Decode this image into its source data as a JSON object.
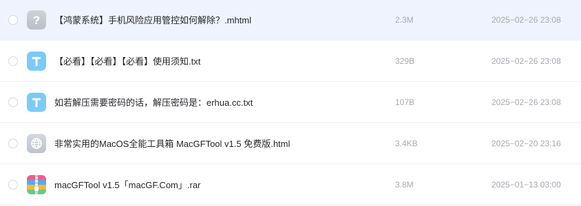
{
  "files": [
    {
      "name": "【鸿蒙系统】手机风险应用管控如何解除？.mhtml",
      "size": "2.3M",
      "date": "2025−02−26 23:08",
      "icon": "unknown-file-icon",
      "selected": true
    },
    {
      "name": "【必看】【必看】【必看】使用须知.txt",
      "size": "329B",
      "date": "2025−02−26 23:08",
      "icon": "text-file-icon",
      "selected": false
    },
    {
      "name": "如若解压需要密码的话，解压密码是：erhua.cc.txt",
      "size": "107B",
      "date": "2025−02−26 23:08",
      "icon": "text-file-icon",
      "selected": false
    },
    {
      "name": "非常实用的MacOS全能工具箱 MacGFTool v1.5 免费版.html",
      "size": "3.4KB",
      "date": "2025−02−20 23:16",
      "icon": "web-file-icon",
      "selected": false
    },
    {
      "name": "macGFTool v1.5「macGF.Com」.rar",
      "size": "3.8M",
      "date": "2025−01−13 03:00",
      "icon": "archive-file-icon",
      "selected": false
    }
  ],
  "colors": {
    "selected_row_bg": "#eef3fe",
    "name_text": "#25262b",
    "meta_text": "#a6a9b0",
    "txt_icon": "#7ccbf7"
  }
}
